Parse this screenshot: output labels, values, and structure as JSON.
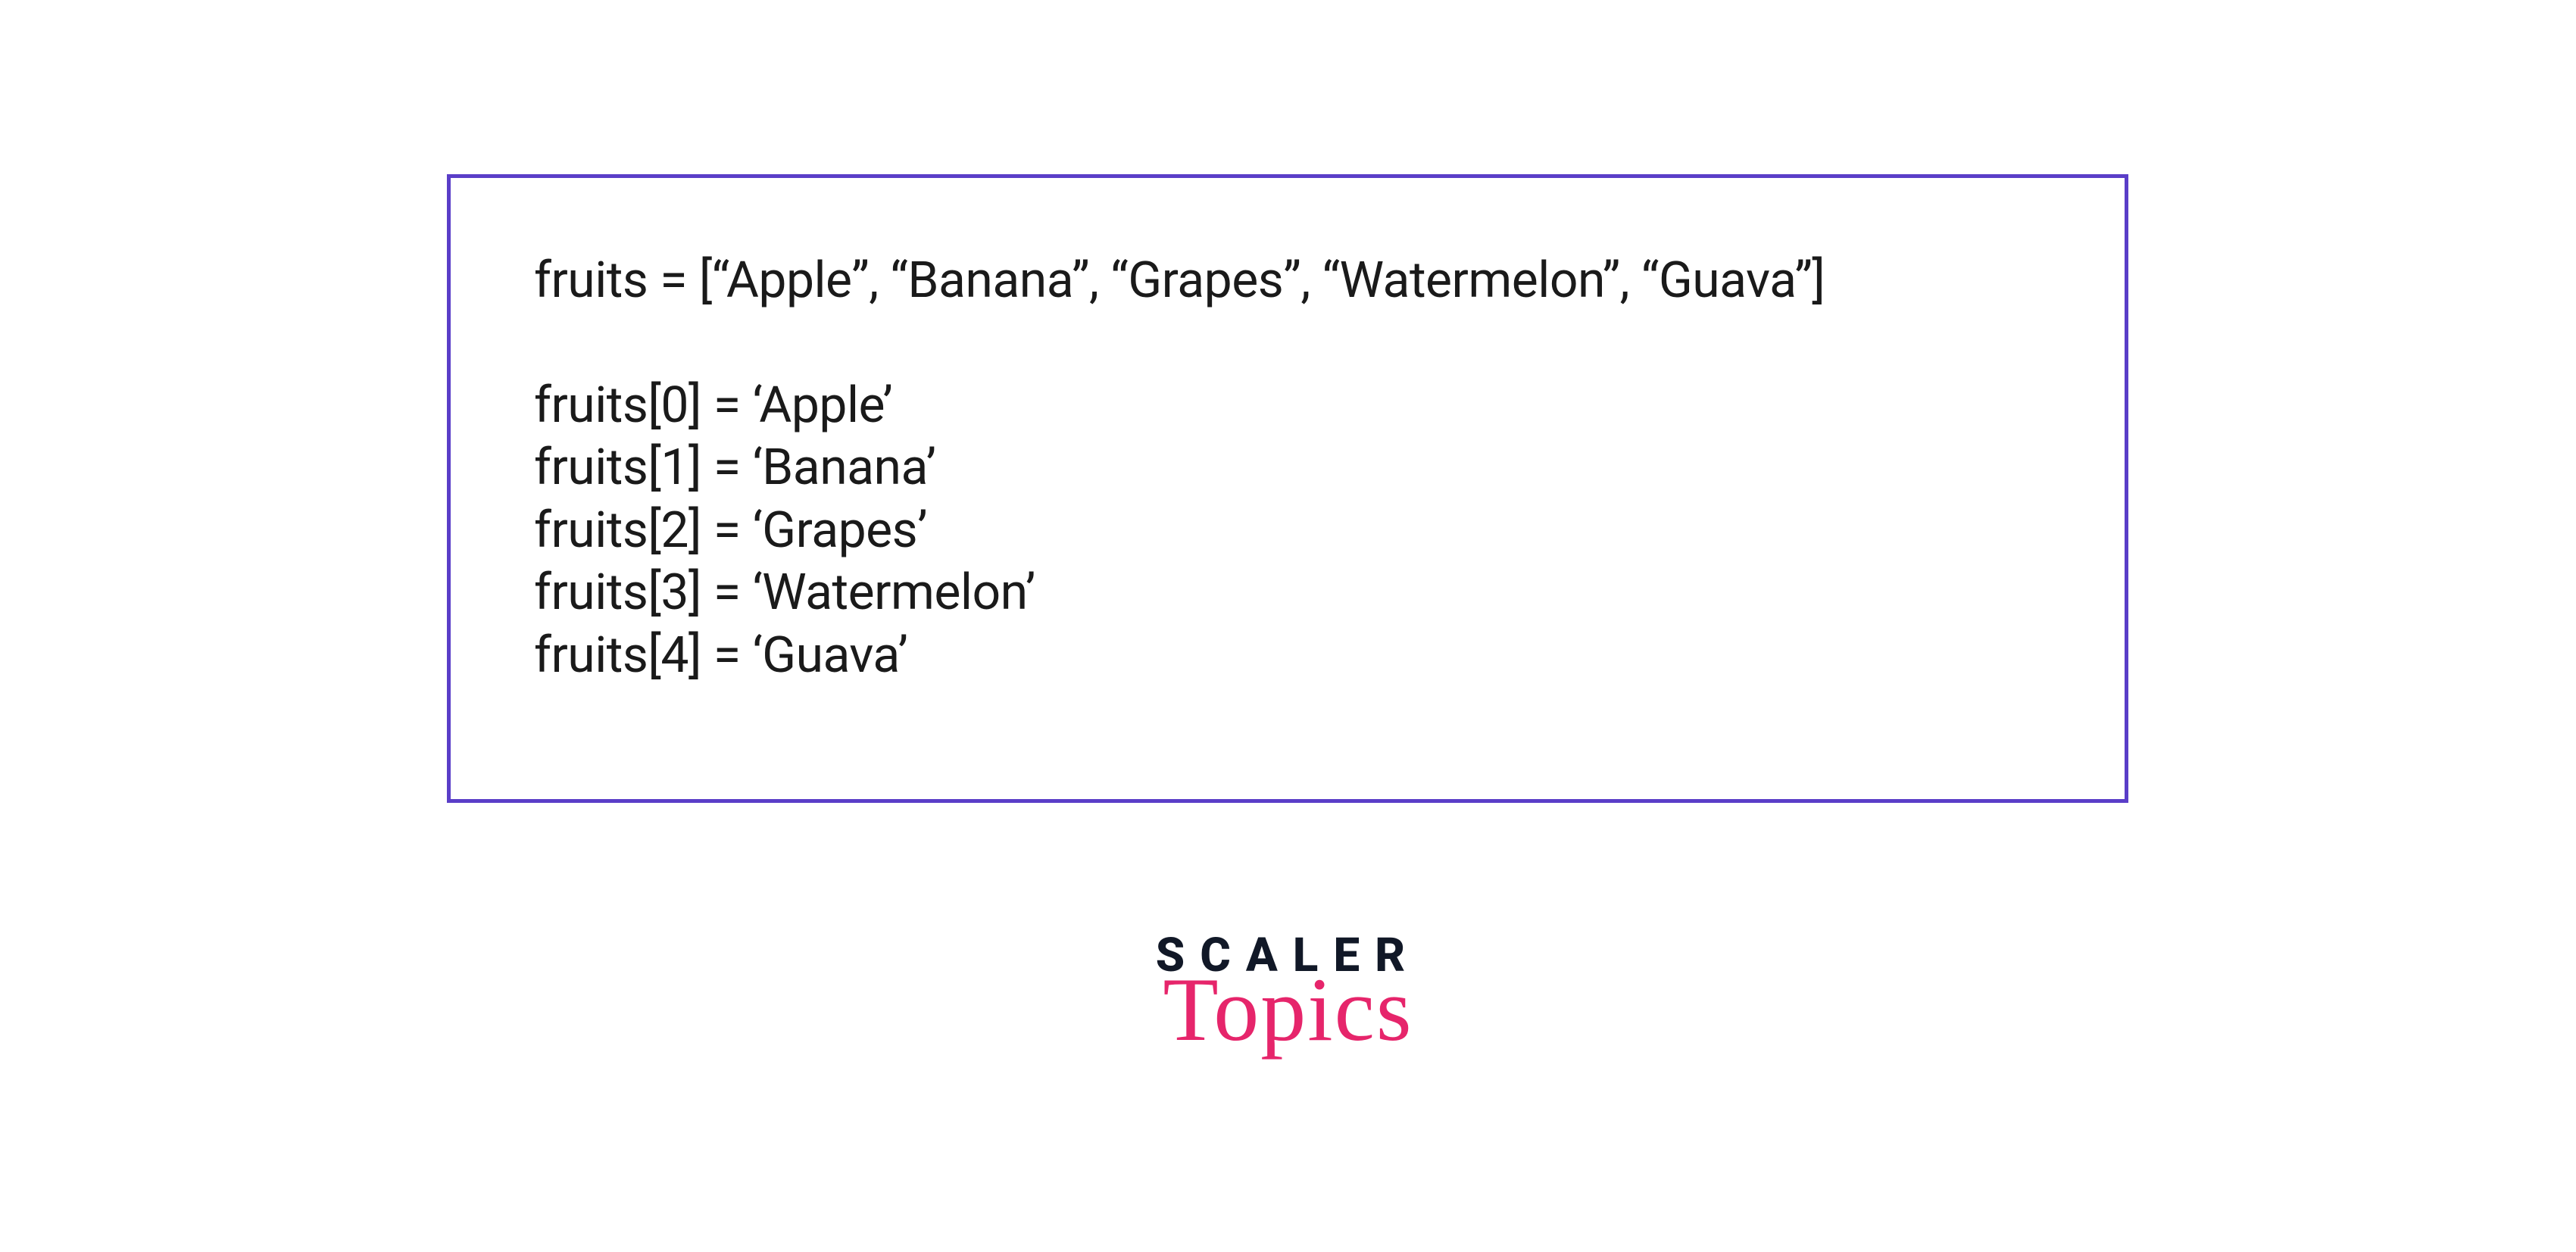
{
  "code": {
    "declaration": "fruits = [“Apple”, “Banana”, “Grapes”, “Watermelon”, “Guava”]",
    "lines": [
      "fruits[0] = ‘Apple’",
      "fruits[1] = ‘Banana’",
      "fruits[2] = ‘Grapes’",
      "fruits[3] = ‘Watermelon’",
      "fruits[4] = ‘Guava’"
    ]
  },
  "brand": {
    "top": "SCALER",
    "bottom": "Topics"
  }
}
